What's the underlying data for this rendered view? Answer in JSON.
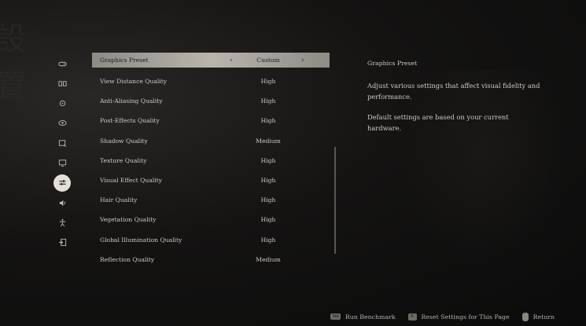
{
  "sidebar": {
    "icons": [
      "gamepad-icon",
      "controls-icon",
      "target-icon",
      "eye-icon",
      "search-monitor-icon",
      "display-icon",
      "graphics-sliders-icon",
      "audio-icon",
      "accessibility-icon",
      "exit-icon"
    ],
    "active_index": 6
  },
  "settings": {
    "preset": {
      "label": "Graphics Preset",
      "value": "Custom",
      "left_arrow": "‹",
      "right_arrow": "›"
    },
    "rows": [
      {
        "label": "View Distance Quality",
        "value": "High"
      },
      {
        "label": "Anti-Aliasing Quality",
        "value": "High"
      },
      {
        "label": "Post-Effects Quality",
        "value": "High"
      },
      {
        "label": "Shadow Quality",
        "value": "Medium"
      },
      {
        "label": "Texture Quality",
        "value": "High"
      },
      {
        "label": "Visual Effect Quality",
        "value": "High"
      },
      {
        "label": "Hair Quality",
        "value": "High"
      },
      {
        "label": "Vegetation Quality",
        "value": "High"
      },
      {
        "label": "Global Illumination Quality",
        "value": "High"
      },
      {
        "label": "Reflection Quality",
        "value": "Medium"
      }
    ]
  },
  "description": {
    "title": "Graphics Preset",
    "paragraph1": "Adjust various settings that affect visual fidelity and performance.",
    "paragraph2": "Default settings are based on your current hardware."
  },
  "footer": {
    "benchmark_key": "Tab",
    "benchmark_label": "Run Benchmark",
    "reset_key": "R",
    "reset_label": "Reset Settings for This Page",
    "return_label": "Return"
  }
}
